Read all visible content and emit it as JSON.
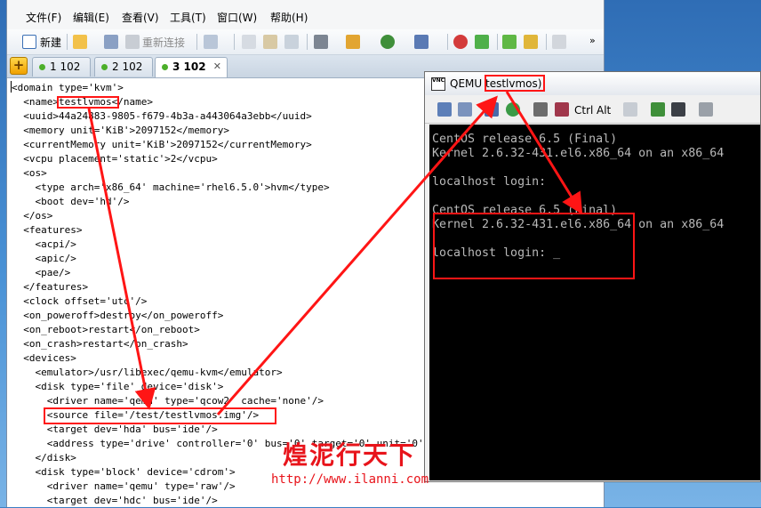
{
  "menu": {
    "items": [
      "文件(F)",
      "编辑(E)",
      "查看(V)",
      "工具(T)",
      "窗口(W)",
      "帮助(H)"
    ]
  },
  "toolbar": {
    "new_label": "新建",
    "reconnect_label": "重新连接",
    "icons": [
      "new-session-icon",
      "open-folder-icon",
      "connect-icon",
      "reconnect-icon",
      "properties-icon",
      "copy-icon",
      "paste-icon",
      "find-icon",
      "print-icon",
      "transfer-icon",
      "globe-icon",
      "script-icon",
      "tools-icon",
      "green-check-icon",
      "layout-icon",
      "lock-icon",
      "keyboard-icon",
      "overflow-icon"
    ]
  },
  "tabs": [
    {
      "label": "1 102",
      "active": false
    },
    {
      "label": "2 102",
      "active": false
    },
    {
      "label": "3 102",
      "active": true
    }
  ],
  "editor": {
    "lines": [
      "<domain type='kvm'>",
      "  <name>testlvmos</name>",
      "  <uuid>44a24883-9805-f679-4b3a-a443064a3ebb</uuid>",
      "  <memory unit='KiB'>2097152</memory>",
      "  <currentMemory unit='KiB'>2097152</currentMemory>",
      "  <vcpu placement='static'>2</vcpu>",
      "  <os>",
      "    <type arch='x86_64' machine='rhel6.5.0'>hvm</type>",
      "    <boot dev='hd'/>",
      "  </os>",
      "  <features>",
      "    <acpi/>",
      "    <apic/>",
      "    <pae/>",
      "  </features>",
      "  <clock offset='utc'/>",
      "  <on_poweroff>destroy</on_poweroff>",
      "  <on_reboot>restart</on_reboot>",
      "  <on_crash>restart</on_crash>",
      "  <devices>",
      "    <emulator>/usr/libexec/qemu-kvm</emulator>",
      "    <disk type='file' device='disk'>",
      "      <driver name='qemu' type='qcow2' cache='none'/>",
      "      <source file='/test/testlvmos.img'/>",
      "      <target dev='hda' bus='ide'/>",
      "      <address type='drive' controller='0' bus='0' target='0' unit='0'/>",
      "    </disk>",
      "    <disk type='block' device='cdrom'>",
      "      <driver name='qemu' type='raw'/>",
      "      <target dev='hdc' bus='ide'/>"
    ]
  },
  "qemu": {
    "title_prefix": "QEMU",
    "title_name": "testlvmos)",
    "toolbar_ctrl": "Ctrl",
    "toolbar_alt": "Alt",
    "console": [
      "CentOS release 6.5 (Final)",
      "Kernel 2.6.32-431.el6.x86_64 on an x86_64",
      "",
      "localhost login:",
      "",
      "CentOS release 6.5 (Final)",
      "Kernel 2.6.32-431.el6.x86_64 on an x86_64",
      "",
      "localhost login: _"
    ]
  },
  "watermark": {
    "brand": "煌泥行天下",
    "url": "http://www.ilanni.com"
  },
  "colors": {
    "annotation": "#ff1515",
    "tab_dot": "#4caf2a",
    "console_text": "#b9b9b9"
  }
}
